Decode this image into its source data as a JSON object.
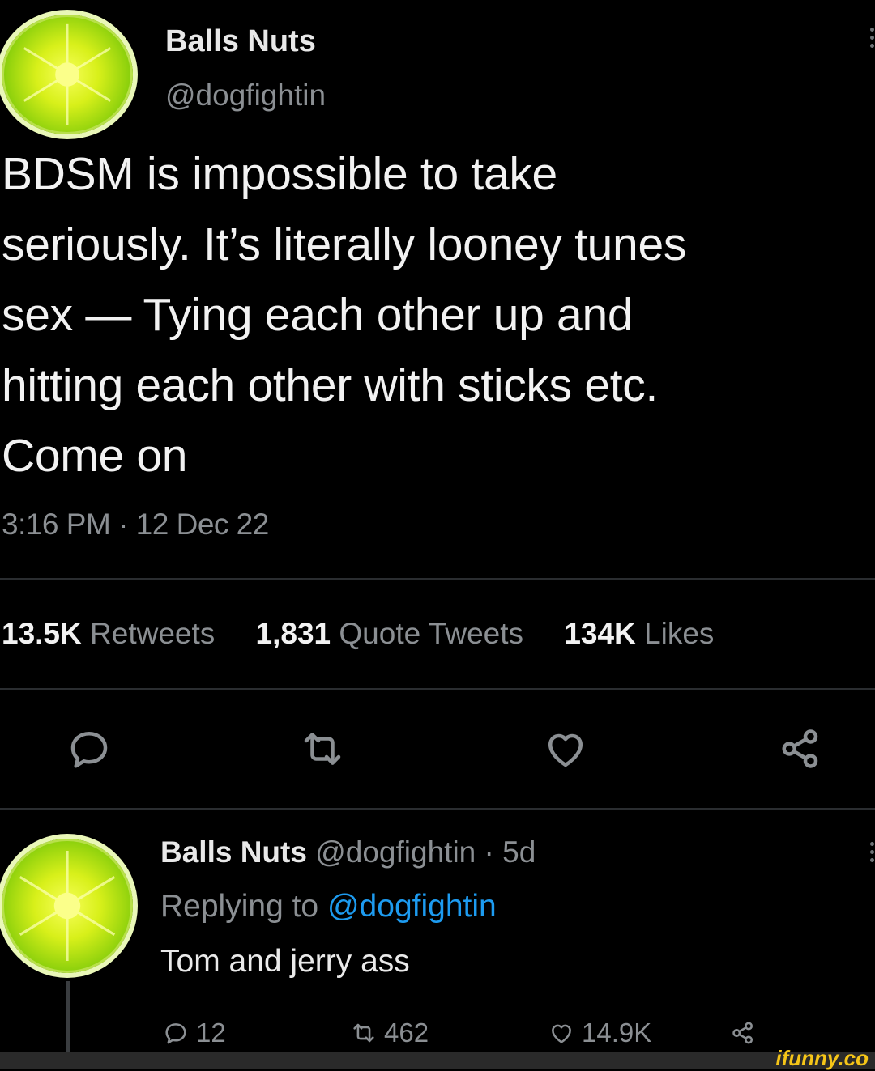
{
  "tweet": {
    "author_name": "Balls Nuts",
    "author_handle": "@dogfightin",
    "text": "BDSM is impossible to take\nseriously. It’s literally looney tunes\nsex — Tying each other up and\nhitting each other with sticks etc.\nCome on",
    "timestamp": "3:16 PM · 12 Dec 22",
    "stats": {
      "retweets_count": "13.5K",
      "retweets_label": "Retweets",
      "quotes_count": "1,831",
      "quotes_label": "Quote Tweets",
      "likes_count": "134K",
      "likes_label": "Likes"
    },
    "actions": [
      "reply-icon",
      "retweet-icon",
      "like-icon",
      "share-icon"
    ]
  },
  "reply": {
    "author_name": "Balls Nuts",
    "author_handle": "@dogfightin",
    "age": "· 5d",
    "replying_prefix": "Replying to",
    "replying_handle": "@dogfightin",
    "text": "Tom and jerry ass",
    "reply_count": "12",
    "retweet_count": "462",
    "like_count": "14.9K"
  },
  "watermark": "ifunny.co",
  "colors": {
    "background": "#000000",
    "muted": "#8b8f93",
    "link": "#1d9bf0",
    "avatar": "#b8e04a"
  }
}
